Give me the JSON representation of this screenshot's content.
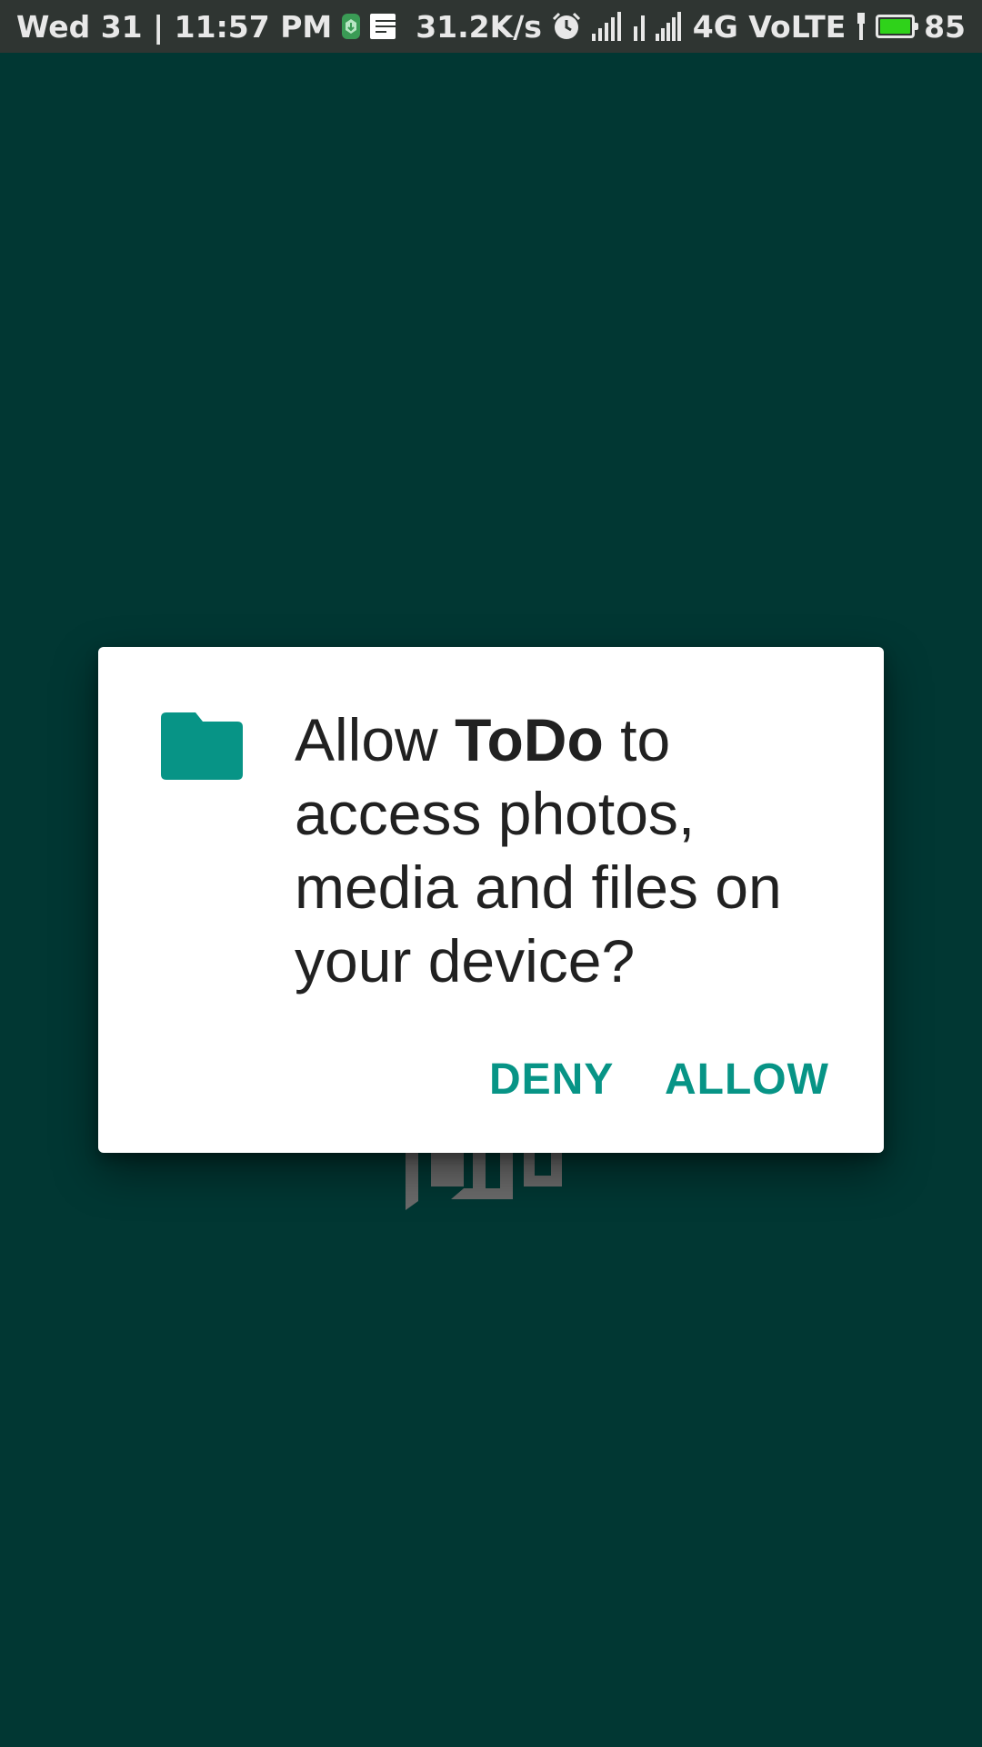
{
  "status_bar": {
    "datetime": "Wed 31 | 11:57 PM",
    "net_speed": "31.2K/s",
    "network": "4G VoLTE",
    "battery_level": "85",
    "icons": [
      "app-notification-icon",
      "message-icon",
      "alarm-icon",
      "signal-icon",
      "signal-secondary-icon",
      "charging-icon",
      "battery-icon"
    ]
  },
  "splash": {
    "logo_icon": "todo-logo-icon"
  },
  "permission_dialog": {
    "icon": "folder-icon",
    "message_prefix": "Allow ",
    "app_name": "ToDo",
    "message_suffix": " to access photos, media and files on your device?",
    "deny_label": "DENY",
    "allow_label": "ALLOW"
  },
  "colors": {
    "background": "#013733",
    "status_bar": "#2f3532",
    "accent": "#079486",
    "battery_fill": "#2fd21a"
  }
}
